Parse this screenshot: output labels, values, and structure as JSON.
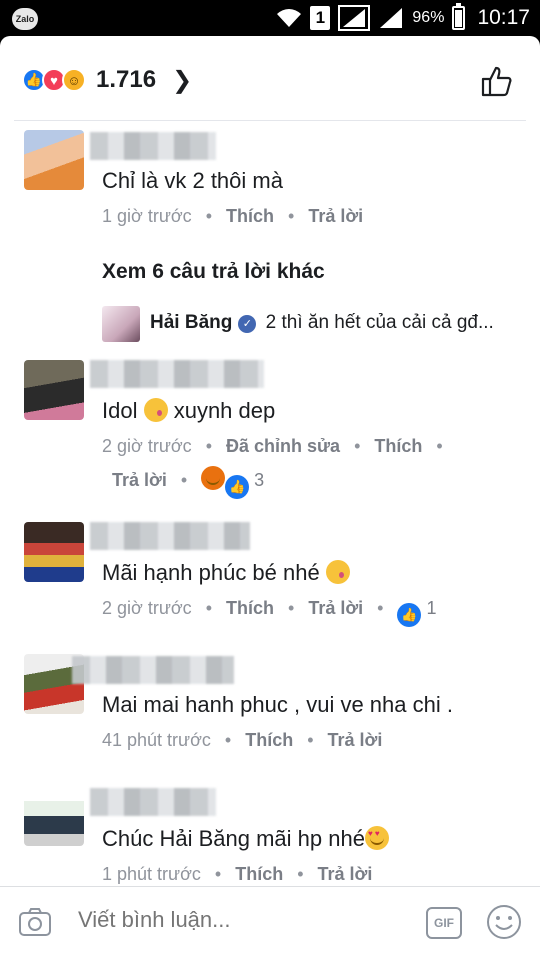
{
  "status_bar": {
    "sim": "1",
    "battery": "96%",
    "time": "10:17",
    "app_icon_label": "Zalo",
    "battery_level": 0.96
  },
  "header": {
    "reaction_count": "1.716",
    "reactions": [
      "like",
      "love",
      "haha"
    ]
  },
  "comments": [
    {
      "text": "Chỉ là vk 2 thôi mà",
      "time": "1 giờ trước",
      "actions": [
        "Thích",
        "Trả lời"
      ]
    },
    {
      "text": "Idol ",
      "text_after": " xuynh dep",
      "time": "2 giờ trước",
      "edited": "Đã chỉnh sửa",
      "actions": [
        "Thích",
        "Trả lời"
      ],
      "reaction_count": "3"
    },
    {
      "text": "Mãi hạnh phúc bé nhé",
      "time": "2 giờ trước",
      "actions": [
        "Thích",
        "Trả lời"
      ],
      "reaction_count": "1"
    },
    {
      "text": "Mai mai hanh phuc , vui ve nha chi .",
      "time": "41 phút trước",
      "actions": [
        "Thích",
        "Trả lời"
      ]
    },
    {
      "text": "Chúc Hải Băng mãi hp nhé",
      "time": "1 phút trước",
      "actions": [
        "Thích",
        "Trả lời"
      ]
    }
  ],
  "more_replies": "Xem 6 câu trả lời khác",
  "reply_preview": {
    "name": "Hải Băng",
    "text": "2 thì ăn hết của cải cả gđ..."
  },
  "composer": {
    "placeholder": "Viết bình luận...",
    "gif_label": "GIF"
  },
  "separator": "•",
  "colors": {
    "like_blue": "#1877f2",
    "meta_grey": "#90949c",
    "text": "#1c1e21"
  }
}
